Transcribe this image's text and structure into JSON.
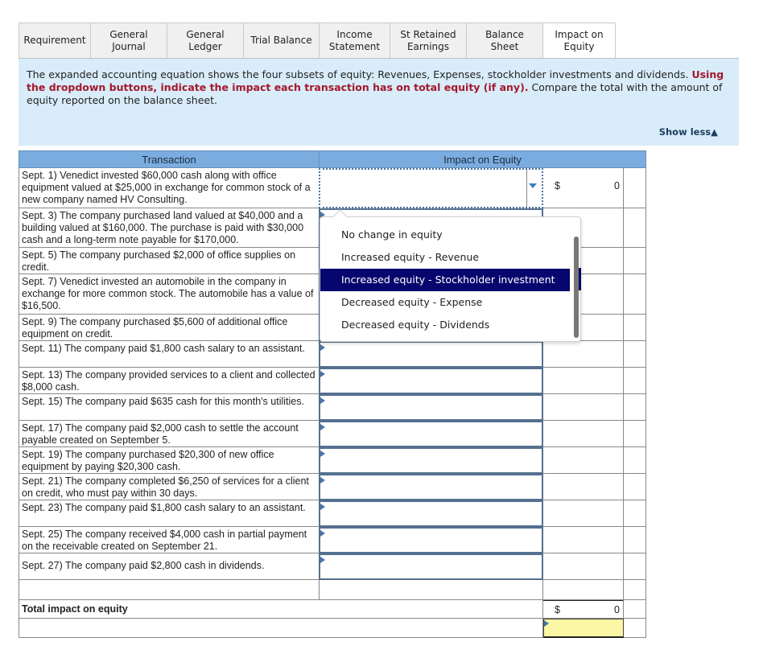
{
  "tabs": [
    {
      "label": "Requirement",
      "active": false
    },
    {
      "label": "General Journal",
      "active": false
    },
    {
      "label": "General Ledger",
      "active": false
    },
    {
      "label": "Trial Balance",
      "active": false
    },
    {
      "label": "Income Statement",
      "active": false
    },
    {
      "label": "St Retained Earnings",
      "active": false
    },
    {
      "label": "Balance Sheet",
      "active": false
    },
    {
      "label": "Impact on Equity",
      "active": true
    }
  ],
  "instructions": {
    "intro": "The expanded accounting equation shows the four subsets of equity: Revenues, Expenses, stockholder investments and dividends. ",
    "emphasis": "Using the dropdown buttons, indicate the impact each transaction has on total equity (if any).",
    "outro": " Compare the total with the amount of equity reported on the balance sheet.",
    "show_less": "Show less",
    "show_less_icon": "triangle-up-icon"
  },
  "table": {
    "headers": {
      "transaction": "Transaction",
      "impact": "Impact on Equity"
    },
    "rows": [
      {
        "transaction": "Sept. 1)  Venedict invested $60,000 cash along with office equipment valued at $25,000 in exchange for common stock of a new company named HV Consulting.",
        "impact": "",
        "currency": "$",
        "amount": "0"
      },
      {
        "transaction": "Sept. 3)  The company purchased land valued at $40,000 and a building valued at $160,000. The purchase is paid with $30,000 cash and a long-term note payable for $170,000.",
        "impact": ""
      },
      {
        "transaction": "Sept. 5)  The company purchased $2,000 of office supplies on credit.",
        "impact": ""
      },
      {
        "transaction": "Sept. 7)  Venedict invested an automobile in the company in exchange for more common stock. The automobile has a value of $16,500.",
        "impact": ""
      },
      {
        "transaction": "Sept. 9)  The company purchased $5,600 of additional office equipment on credit.",
        "impact": ""
      },
      {
        "transaction": "Sept. 11)  The company paid $1,800 cash salary to an assistant.",
        "impact": ""
      },
      {
        "transaction": "Sept. 13)  The company provided services to a client and collected $8,000 cash.",
        "impact": ""
      },
      {
        "transaction": "Sept. 15)  The company paid $635 cash for this month's utilities.",
        "impact": ""
      },
      {
        "transaction": "Sept. 17)  The company paid $2,000 cash to settle the account payable created on September 5.",
        "impact": ""
      },
      {
        "transaction": "Sept. 19)  The company purchased $20,300 of new office equipment by paying $20,300 cash.",
        "impact": ""
      },
      {
        "transaction": "Sept. 21)  The company completed $6,250 of services for a client on credit, who must pay within 30 days.",
        "impact": ""
      },
      {
        "transaction": "Sept. 23)  The company paid $1,800 cash salary to an assistant.",
        "impact": ""
      },
      {
        "transaction": "Sept. 25)  The company received $4,000 cash in partial payment on the receivable created on September 21.",
        "impact": ""
      },
      {
        "transaction": "Sept. 27)  The company paid $2,800 cash in dividends.",
        "impact": ""
      }
    ],
    "total": {
      "label": "Total impact on equity",
      "currency": "$",
      "amount": "0",
      "answer_value": ""
    }
  },
  "dropdown": {
    "open": true,
    "options": [
      "No change in equity",
      "Increased equity - Revenue",
      "Increased equity - Stockholder investment",
      "Decreased equity - Expense",
      "Decreased equity - Dividends"
    ],
    "highlighted": "Increased equity - Stockholder investment"
  }
}
